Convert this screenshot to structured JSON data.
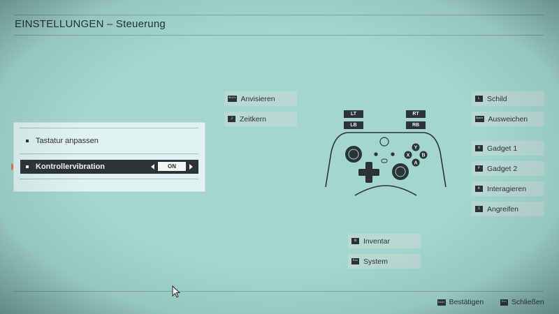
{
  "header": {
    "title": "EINSTELLUNGEN – Steuerung"
  },
  "options_panel": {
    "items": [
      {
        "label": "Tastatur anpassen"
      },
      {
        "label": "Kontrollervibration",
        "value": "ON"
      }
    ]
  },
  "left_bindings": [
    {
      "key": "Shift",
      "label": "Anvisieren"
    },
    {
      "key": "J",
      "label": "Zeitkern"
    }
  ],
  "right_bindings": [
    {
      "key": "L",
      "label": "Schild"
    },
    {
      "key": "Space",
      "label": "Ausweichen"
    },
    {
      "key": "O",
      "label": "Gadget 1"
    },
    {
      "key": "P",
      "label": "Gadget 2"
    },
    {
      "key": "K",
      "label": "Interagieren"
    },
    {
      "key": "I",
      "label": "Angreifen"
    }
  ],
  "bottom_bindings": [
    {
      "key": "N",
      "label": "Inventar"
    },
    {
      "key": "Esc",
      "label": "System"
    }
  ],
  "triggers": {
    "lt": "LT",
    "rt": "RT",
    "lb": "LB",
    "rb": "RB"
  },
  "face_buttons": {
    "y": "Y",
    "x": "X",
    "b": "B",
    "a": "A"
  },
  "footer": {
    "confirm": {
      "key": "Enter",
      "label": "Bestätigen"
    },
    "close": {
      "key": "Esc",
      "label": "Schließen"
    }
  },
  "colors": {
    "background": "#a2d6ce",
    "panel": "#dff2ef",
    "selected": "#2c3335",
    "accent_arrow": "#e2725b"
  }
}
